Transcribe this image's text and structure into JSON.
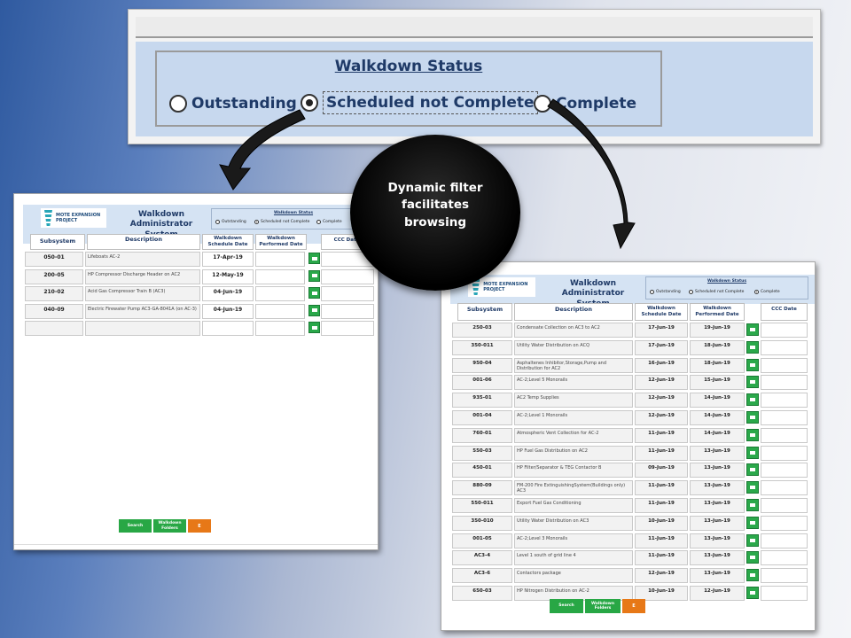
{
  "filter_panel": {
    "title": "Walkdown Status",
    "options": [
      {
        "label": "Outstanding",
        "selected": false
      },
      {
        "label": "Scheduled not Complete",
        "selected": true
      },
      {
        "label": "Complete",
        "selected": false
      }
    ]
  },
  "callout": {
    "text": "Dynamic filter\nfacilitates\nbrowsing"
  },
  "left_screen": {
    "logo_text": "MOTE EXPANSION PROJECT",
    "app_title": "Walkdown\nAdministrator System",
    "status_box": {
      "title": "Walkdown Status",
      "options": [
        {
          "label": "Outstanding",
          "selected": false
        },
        {
          "label": "Scheduled not Complete",
          "selected": true
        },
        {
          "label": "Complete",
          "selected": false
        }
      ]
    },
    "columns": [
      "Subsystem",
      "Description",
      "Walkdown\nSchedule Date",
      "Walkdown\nPerformed Date",
      "CCC Date"
    ],
    "rows": [
      {
        "subsystem": "050-01",
        "description": "Lifeboats AC-2",
        "schedule": "17-Apr-19",
        "performed": ""
      },
      {
        "subsystem": "200-05",
        "description": "HP Compressor Discharge Header on AC2",
        "schedule": "12-May-19",
        "performed": ""
      },
      {
        "subsystem": "210-02",
        "description": "Acid Gas Compressor Train B  (AC3)",
        "schedule": "04-Jun-19",
        "performed": ""
      },
      {
        "subsystem": "040-09",
        "description": "Electric Firewater Pump AC3-GA-8041A (on AC-3)",
        "schedule": "04-Jun-19",
        "performed": ""
      },
      {
        "subsystem": "",
        "description": "",
        "schedule": "",
        "performed": ""
      }
    ],
    "buttons": {
      "search": "Search",
      "folders": "Walkdown\nFolders",
      "exit": "E"
    }
  },
  "right_screen": {
    "logo_text": "MOTE EXPANSION PROJECT",
    "app_title": "Walkdown\nAdministrator System",
    "status_box": {
      "title": "Walkdown Status",
      "options": [
        {
          "label": "Outstanding",
          "selected": false
        },
        {
          "label": "Scheduled not Complete",
          "selected": false
        },
        {
          "label": "Complete",
          "selected": true
        }
      ]
    },
    "columns": [
      "Subsystem",
      "Description",
      "Walkdown\nSchedule Date",
      "Walkdown\nPerformed Date",
      "CCC Date"
    ],
    "rows": [
      {
        "subsystem": "250-03",
        "description": "Condensate Collection on AC3 to AC2",
        "schedule": "17-Jun-19",
        "performed": "19-Jun-19"
      },
      {
        "subsystem": "350-011",
        "description": "Utility Water Distribution on ACQ",
        "schedule": "17-Jun-19",
        "performed": "18-Jun-19"
      },
      {
        "subsystem": "950-04",
        "description": "Asphaltenes Inhibitor,Storage,Pump and Distribution  for AC2",
        "schedule": "16-Jun-19",
        "performed": "18-Jun-19"
      },
      {
        "subsystem": "001-06",
        "description": "AC-2;Level 5 Monorails",
        "schedule": "12-Jun-19",
        "performed": "15-Jun-19"
      },
      {
        "subsystem": "935-01",
        "description": "AC2 Temp Supplies",
        "schedule": "12-Jun-19",
        "performed": "14-Jun-19"
      },
      {
        "subsystem": "001-04",
        "description": "AC-2;Level 1 Monorails",
        "schedule": "12-Jun-19",
        "performed": "14-Jun-19"
      },
      {
        "subsystem": "760-01",
        "description": "Atmospheric Vent Collection for AC-2",
        "schedule": "11-Jun-19",
        "performed": "14-Jun-19"
      },
      {
        "subsystem": "550-03",
        "description": "HP Fuel Gas Distribution on  AC2",
        "schedule": "11-Jun-19",
        "performed": "13-Jun-19"
      },
      {
        "subsystem": "450-01",
        "description": "HP Filter/Separator & TEG Contactor B",
        "schedule": "09-Jun-19",
        "performed": "13-Jun-19"
      },
      {
        "subsystem": "880-09",
        "description": "FM-200 Fire ExtinguishingSystem(Buildings only) AC3",
        "schedule": "11-Jun-19",
        "performed": "13-Jun-19"
      },
      {
        "subsystem": "550-011",
        "description": "Export Fuel Gas Conditioning",
        "schedule": "11-Jun-19",
        "performed": "13-Jun-19"
      },
      {
        "subsystem": "350-010",
        "description": "Utility Water Distribution on AC3",
        "schedule": "10-Jun-19",
        "performed": "13-Jun-19"
      },
      {
        "subsystem": "001-05",
        "description": "AC-2;Level 3 Monorails",
        "schedule": "11-Jun-19",
        "performed": "13-Jun-19"
      },
      {
        "subsystem": "AC3-4",
        "description": "Level 1 south of grid line 4",
        "schedule": "11-Jun-19",
        "performed": "13-Jun-19"
      },
      {
        "subsystem": "AC3-6",
        "description": "Contactors package",
        "schedule": "12-Jun-19",
        "performed": "13-Jun-19"
      },
      {
        "subsystem": "650-03",
        "description": "HP Nitrogen Distribution on AC-2",
        "schedule": "10-Jun-19",
        "performed": "12-Jun-19"
      }
    ],
    "buttons": {
      "search": "Search",
      "folders": "Walkdown\nFolders",
      "exit": "E"
    }
  }
}
